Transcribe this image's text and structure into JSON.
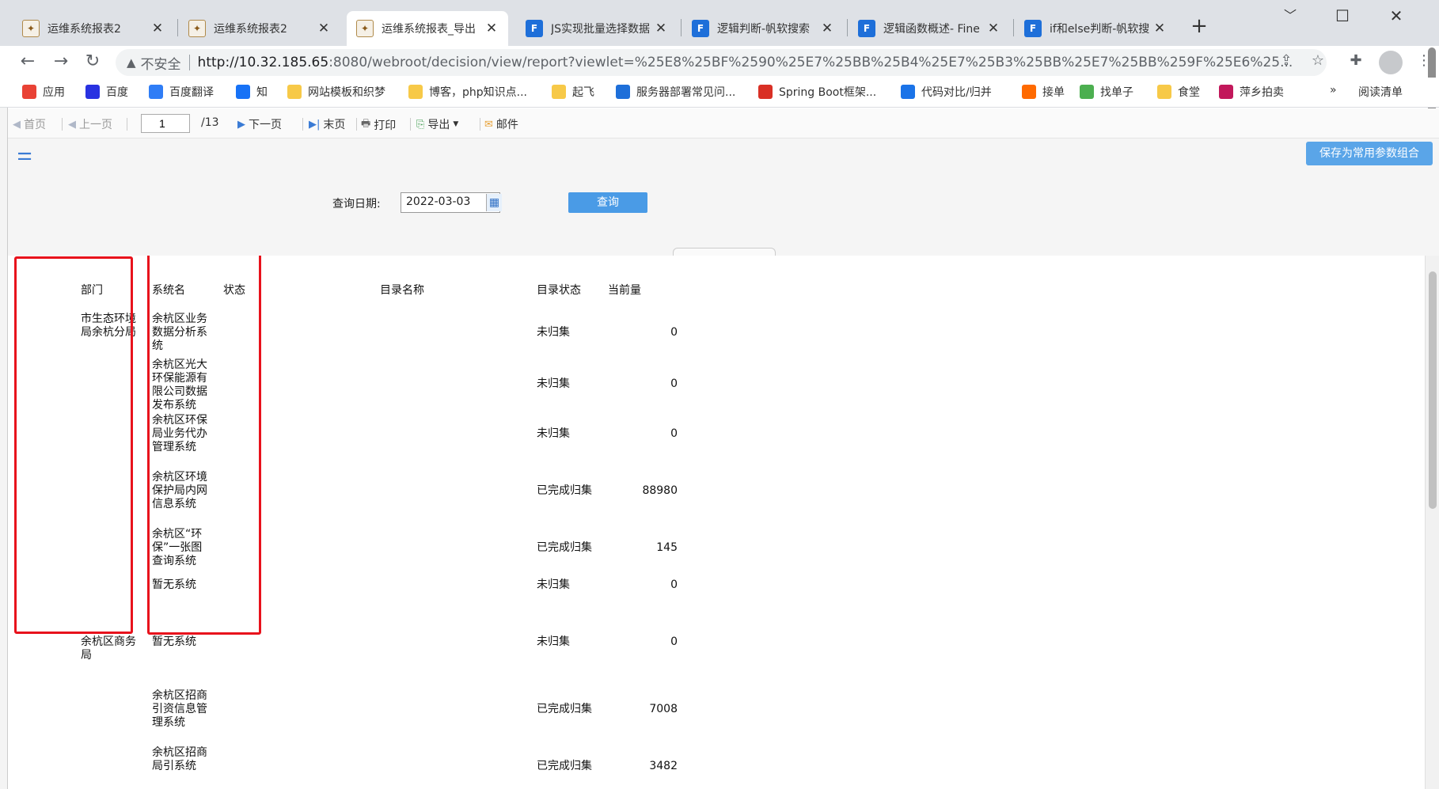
{
  "browser": {
    "tabs": [
      {
        "title": "运维系统报表2",
        "icon": "report-icon"
      },
      {
        "title": "运维系统报表2",
        "icon": "report-icon"
      },
      {
        "title": "运维系统报表_导出",
        "icon": "report-icon",
        "active": true
      },
      {
        "title": "JS实现批量选择数据",
        "icon": "fine-icon"
      },
      {
        "title": "逻辑判断-帆软搜索",
        "icon": "fine-icon"
      },
      {
        "title": "逻辑函数概述- Fine",
        "icon": "fine-icon"
      },
      {
        "title": "if和else判断-帆软搜",
        "icon": "fine-icon"
      }
    ],
    "new_tab": "+",
    "window_controls": {
      "minimize": "﹀",
      "maximize": "☐",
      "close": "✕"
    },
    "security_text": "不安全",
    "url_host": "http://10.32.185.65",
    "url_path": ":8080/webroot/decision/view/report?viewlet=%25E8%25BF%2590%25E7%25BB%25B4%25E7%25B3%25BB%25E7%25BB%259F%25E6%25..."
  },
  "bookmarks": [
    {
      "label": "应用",
      "color": "#e94235"
    },
    {
      "label": "百度",
      "color": "#2932e1"
    },
    {
      "label": "百度翻译",
      "color": "#2f7df6"
    },
    {
      "label": "知",
      "color": "#1772f6"
    },
    {
      "label": "网站模板和织梦",
      "color": "#f7c948"
    },
    {
      "label": "博客，php知识点...",
      "color": "#f7c948"
    },
    {
      "label": "起飞",
      "color": "#f7c948"
    },
    {
      "label": "服务器部署常见问...",
      "color": "#1e6fd9"
    },
    {
      "label": "Spring Boot框架...",
      "color": "#d93025"
    },
    {
      "label": "代码对比/归并",
      "color": "#1a73e8"
    },
    {
      "label": "接单",
      "color": "#ff6a00"
    },
    {
      "label": "找单子",
      "color": "#4caf50"
    },
    {
      "label": "食堂",
      "color": "#f7c948"
    },
    {
      "label": "萍乡拍卖",
      "color": "#c2185b"
    }
  ],
  "bookmarks_more": "»",
  "reading_list": "阅读清单",
  "report_toolbar": {
    "first": "首页",
    "prev": "上一页",
    "page_value": "1",
    "page_total": "/13",
    "next": "下一页",
    "last": "末页",
    "print": "打印",
    "export": "导出",
    "email": "邮件"
  },
  "params": {
    "save_label": "保存为常用参数组合",
    "date_label": "查询日期:",
    "date_value": "2022-03-03",
    "query_label": "查询"
  },
  "report": {
    "headers": {
      "dept": "部门",
      "system": "系统名",
      "status": "状态",
      "catalog": "目录名称",
      "catalog_status": "目录状态",
      "current_amount": "当前量"
    },
    "rows": [
      {
        "dept": "市生态环境局余杭分局",
        "system": "余杭区业务数据分析系统",
        "catalog_status": "未归集",
        "amount": "0"
      },
      {
        "dept": "",
        "system": "余杭区光大环保能源有限公司数据发布系统",
        "catalog_status": "未归集",
        "amount": "0"
      },
      {
        "dept": "",
        "system": "余杭区环保局业务代办管理系统",
        "catalog_status": "未归集",
        "amount": "0"
      },
      {
        "dept": "",
        "system": "余杭区环境保护局内网信息系统",
        "catalog_status": "已完成归集",
        "amount": "88980"
      },
      {
        "dept": "",
        "system": "余杭区“环保”一张图查询系统",
        "catalog_status": "已完成归集",
        "amount": "145"
      },
      {
        "dept": "",
        "system": "暂无系统",
        "catalog_status": "未归集",
        "amount": "0"
      },
      {
        "dept": "余杭区商务局",
        "system": "暂无系统",
        "catalog_status": "未归集",
        "amount": "0"
      },
      {
        "dept": "",
        "system": "余杭区招商引资信息管理系统",
        "catalog_status": "已完成归集",
        "amount": "7008"
      },
      {
        "dept": "",
        "system": "余杭区招商局引系统",
        "catalog_status": "已完成归集",
        "amount": "3482"
      }
    ]
  }
}
